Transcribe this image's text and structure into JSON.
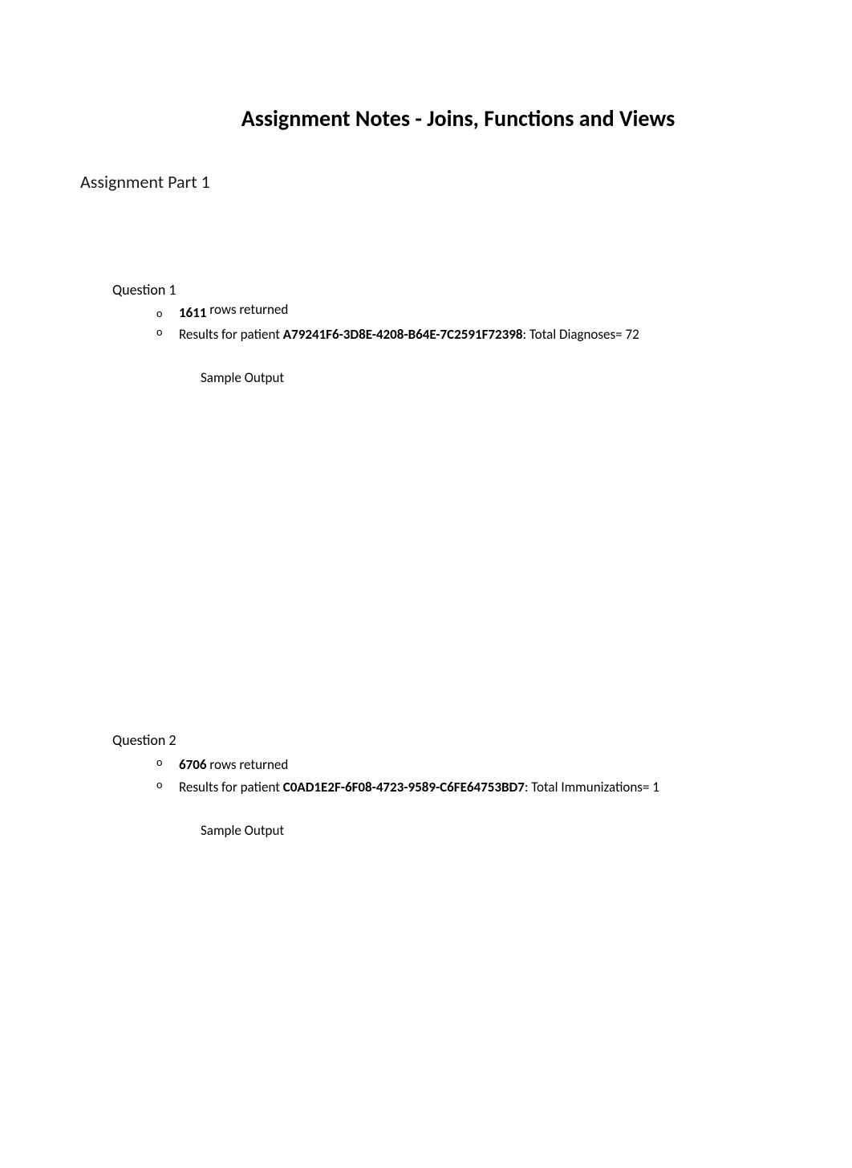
{
  "title": "Assignment Notes - Joins, Functions and Views",
  "subtitle": "Assignment Part 1",
  "q1": {
    "label": "Question 1",
    "rows_count": "1611",
    "rows_suffix": " rows returned",
    "results_prefix": "Results for patient ",
    "patient_id": "A79241F6-3D8E-4208-B64E-7C2591F72398",
    "results_suffix": ": Total Diagnoses= 72",
    "sample_output": "Sample Output"
  },
  "q2": {
    "label": "Question 2",
    "rows_count": "6706",
    "rows_suffix": " rows returned",
    "results_prefix": "Results for patient ",
    "patient_id": "C0AD1E2F-6F08-4723-9589-C6FE64753BD7",
    "results_suffix": ": Total Immunizations= 1",
    "sample_output": "Sample Output"
  }
}
